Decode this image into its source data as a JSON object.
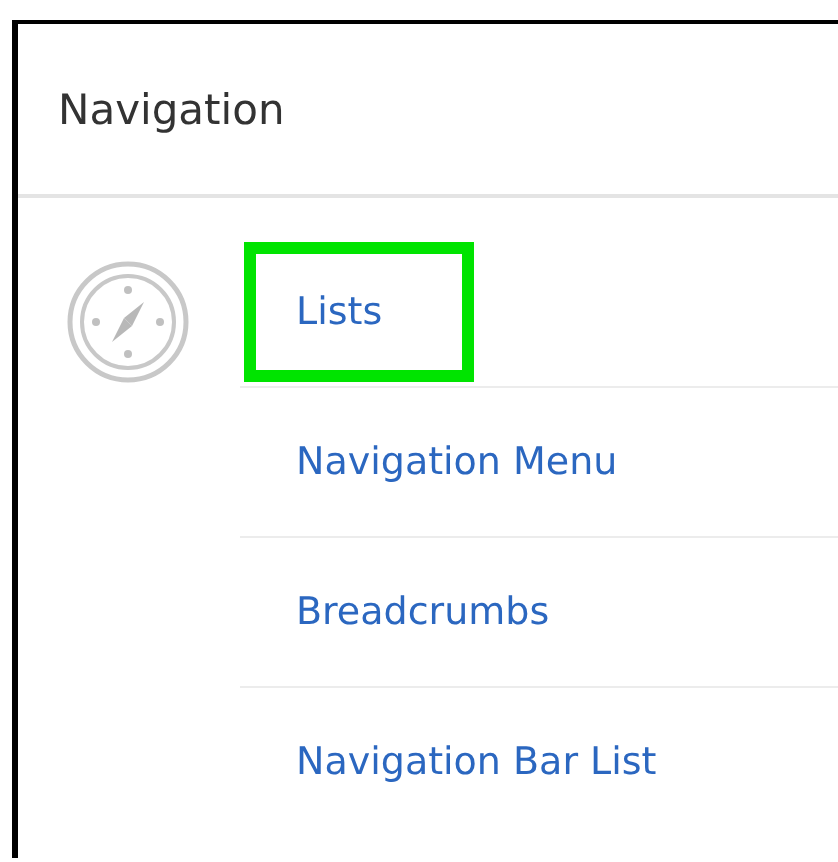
{
  "panel": {
    "title": "Navigation"
  },
  "items": [
    {
      "label": "Lists",
      "selected": true
    },
    {
      "label": "Navigation Menu",
      "selected": false
    },
    {
      "label": "Breadcrumbs",
      "selected": false
    },
    {
      "label": "Navigation Bar List",
      "selected": false
    }
  ]
}
